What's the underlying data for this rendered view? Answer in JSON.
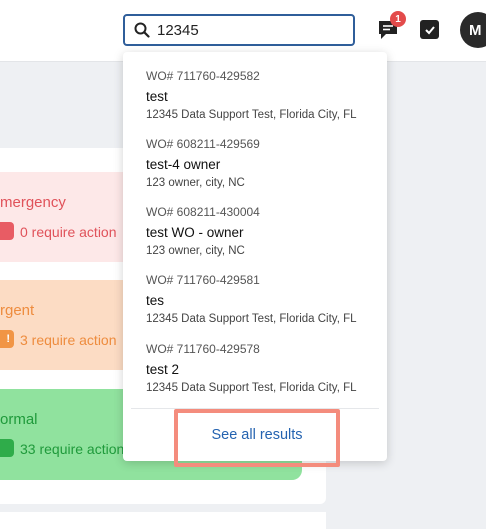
{
  "search": {
    "value": "12345"
  },
  "header": {
    "notification_count": "1",
    "avatar_initial": "M"
  },
  "priorities": [
    {
      "label": "mergency",
      "count_text": "0 require action",
      "chip": ""
    },
    {
      "label": "rgent",
      "count_text": "3 require action",
      "chip": "!"
    },
    {
      "label": "ormal",
      "count_text": "33 require action",
      "chip": ""
    }
  ],
  "results": [
    {
      "wo": "WO# 711760-429582",
      "name": "test",
      "address": "12345 Data Support Test, Florida City, FL"
    },
    {
      "wo": "WO# 608211-429569",
      "name": "test-4 owner",
      "address": "123 owner, city, NC"
    },
    {
      "wo": "WO# 608211-430004",
      "name": "test WO - owner",
      "address": "123 owner, city, NC"
    },
    {
      "wo": "WO# 711760-429581",
      "name": "tes",
      "address": "12345 Data Support Test, Florida City, FL"
    },
    {
      "wo": "WO# 711760-429578",
      "name": "test 2",
      "address": "12345 Data Support Test, Florida City, FL"
    }
  ],
  "see_all_label": "See all results",
  "colors": {
    "accent": "#2f5e9a",
    "highlight": "#f48c7d",
    "link": "#2463b0"
  }
}
